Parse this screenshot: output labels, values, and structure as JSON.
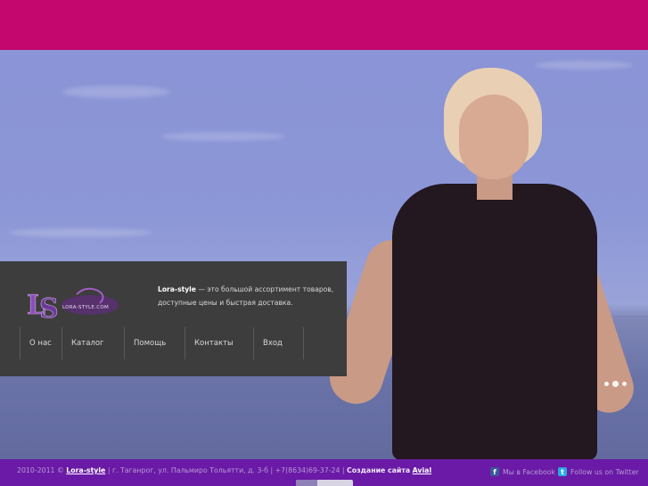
{
  "header": {},
  "hero": {
    "slides": 3,
    "active_slide": 2
  },
  "panel": {
    "logo_text": "LS LORA-STYLE.COM",
    "tagline_brand": "Lora-style",
    "tagline_rest": " — это большой ассортимент товаров, доступные цены и быстрая доставка.",
    "nav": [
      {
        "label": "О нас"
      },
      {
        "label": "Каталог"
      },
      {
        "label": "Помощь"
      },
      {
        "label": "Контакты"
      },
      {
        "label": "Вход"
      }
    ]
  },
  "footer": {
    "years": "2010-2011 © ",
    "brand": "Lora-style",
    "address": " | г. Таганрог, ул. Пальмиро Тольятти, д. 3-б | +7(8634)69-37-24 | ",
    "creation_label": "Создание сайта",
    "creator": "Avial",
    "facebook": "Мы в Facebook",
    "twitter": "Follow us on Twitter"
  },
  "colors": {
    "top_bar": "#c4066f",
    "footer": "#6a1aa6",
    "panel": "#3d3d3d"
  }
}
